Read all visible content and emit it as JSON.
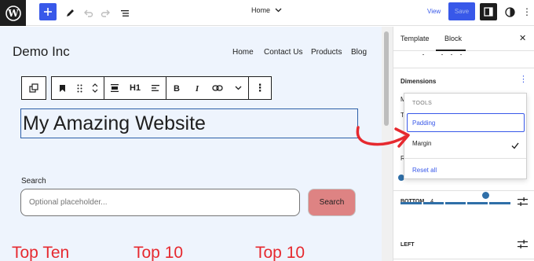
{
  "toolbar": {
    "document_title": "Home",
    "view_label": "View",
    "save_label": "Save"
  },
  "site": {
    "title": "Demo Inc",
    "nav": [
      "Home",
      "Contact Us",
      "Products",
      "Blog"
    ]
  },
  "block_toolbar": {
    "heading_level": "H1"
  },
  "heading": {
    "text": "My Amazing Website"
  },
  "search": {
    "label": "Search",
    "placeholder": "Optional placeholder...",
    "button_label": "Search"
  },
  "promos": [
    "Top Ten",
    "Top 10",
    "Top 10"
  ],
  "sidebar": {
    "tabs": [
      "Template",
      "Block"
    ],
    "dimensions_heading": "Dimensions",
    "bottom_label": "BOTTOM",
    "bottom_value": "4",
    "left_label": "LEFT",
    "fragment_m": "M",
    "fragment_t": "T",
    "fragment_r": "R"
  },
  "tools_popover": {
    "heading": "TOOLS",
    "items": [
      "Padding",
      "Margin"
    ],
    "reset_label": "Reset all"
  },
  "colors": {
    "accent": "#3858e9",
    "promo_red": "#e6292f",
    "search_button": "#de8383",
    "canvas_bg": "#eef4fd"
  }
}
